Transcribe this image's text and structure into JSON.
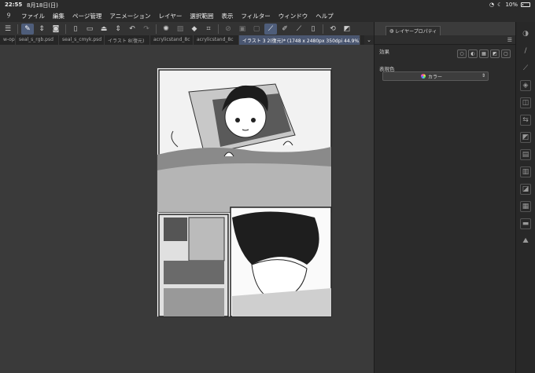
{
  "status": {
    "time": "22:55",
    "date": "8月18日(日)",
    "battery": "10%"
  },
  "menu": {
    "items": [
      "ファイル",
      "編集",
      "ページ管理",
      "アニメーション",
      "レイヤー",
      "選択範囲",
      "表示",
      "フィルター",
      "ウィンドウ",
      "ヘルプ"
    ]
  },
  "tabs": [
    {
      "label": "w-open"
    },
    {
      "label": "seal_s_rgb.psd"
    },
    {
      "label": "seal_s_cmyk.psd"
    },
    {
      "label": "イラスト 8(復元)"
    },
    {
      "label": "acrylicstand_8c"
    },
    {
      "label": "acrylicstand_8c"
    },
    {
      "label": "イラスト 3 2(復元)* (1748 x 2480px 350dpi 44.9%)",
      "active": true
    }
  ],
  "panel": {
    "tab_label": "レイヤープロパティ",
    "effect_label": "効果",
    "color_label": "表現色",
    "color_value": "カラー"
  },
  "colors": {
    "accent": "#4e5d7a",
    "panel_bg": "#2b2b2b",
    "canvas_bg": "#3a3a3a"
  }
}
